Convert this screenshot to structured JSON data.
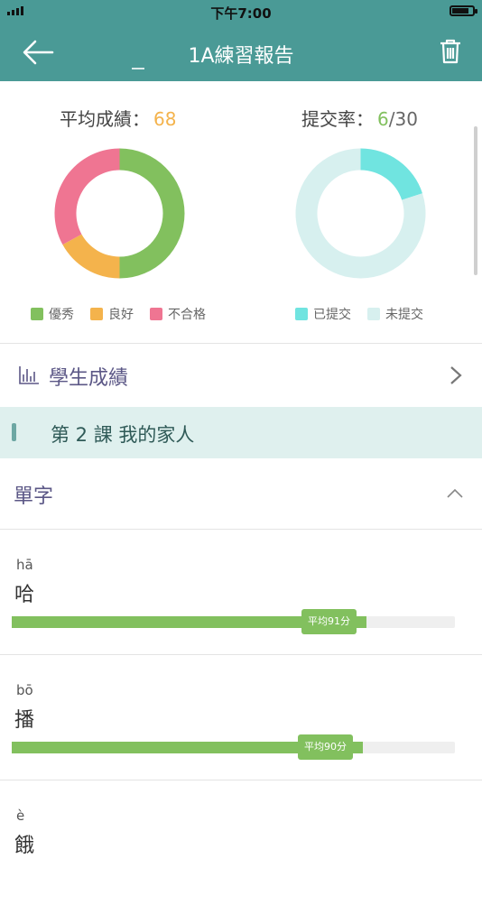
{
  "status_bar": {
    "time": "下午7:00"
  },
  "header": {
    "title": "1A練習報告"
  },
  "stats": {
    "avg_label": "平均成績：",
    "avg_value": "68",
    "submit_label": "提交率：",
    "submit_value": "6",
    "submit_total": "/30",
    "grade_chart": {
      "slices": [
        {
          "label": "優秀",
          "fraction": 0.5,
          "color": "#82c05e"
        },
        {
          "label": "良好",
          "fraction": 0.17,
          "color": "#f4b34c"
        },
        {
          "label": "不合格",
          "fraction": 0.33,
          "color": "#ef7592"
        }
      ]
    },
    "submit_chart": {
      "slices": [
        {
          "label": "已提交",
          "fraction": 0.2,
          "color": "#70e4e0"
        },
        {
          "label": "未提交",
          "fraction": 0.8,
          "color": "#d7f0ef"
        }
      ]
    }
  },
  "colors": {
    "avg_value": "#f4b34c",
    "submit_value": "#82c05e",
    "accent": "#4a9a96"
  },
  "students_row": {
    "label": "學生成績"
  },
  "lesson": {
    "label": "第 2 課 我的家人"
  },
  "section": {
    "label": "單字"
  },
  "words": [
    {
      "pinyin": "hā",
      "char": "哈",
      "avg_label": "平均91分",
      "score": 91
    },
    {
      "pinyin": "bō",
      "char": "播",
      "avg_label": "平均90分",
      "score": 90
    },
    {
      "pinyin": "è",
      "char": "餓",
      "avg_label": "",
      "score": null
    }
  ]
}
